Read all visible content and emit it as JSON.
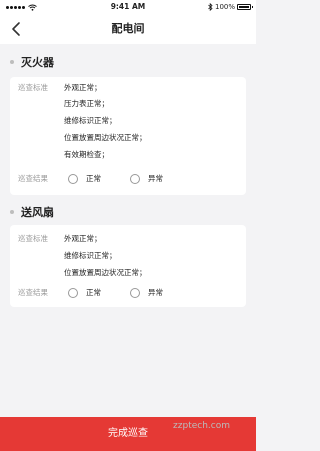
{
  "status_bar": {
    "time": "9:41 AM",
    "battery": "100%",
    "battery_level": 1.0
  },
  "nav": {
    "title": "配电间"
  },
  "sections": [
    {
      "title": "灭火器",
      "standard_label": "巡查标准",
      "standards": [
        "外观正常；",
        "压力表正常；",
        "维修标识正常；",
        "位置放置周边状况正常；",
        "有效期检查；"
      ],
      "result_label": "巡查结果",
      "options": [
        "正常",
        "异常"
      ]
    },
    {
      "title": "送风扇",
      "standard_label": "巡查标准",
      "standards": [
        "外观正常；",
        "维修标识正常；",
        "位置放置周边状况正常；"
      ],
      "result_label": "巡查结果",
      "options": [
        "正常",
        "异常"
      ]
    }
  ],
  "footer": {
    "submit_label": "完成巡查"
  },
  "watermark": "zzptech.com"
}
